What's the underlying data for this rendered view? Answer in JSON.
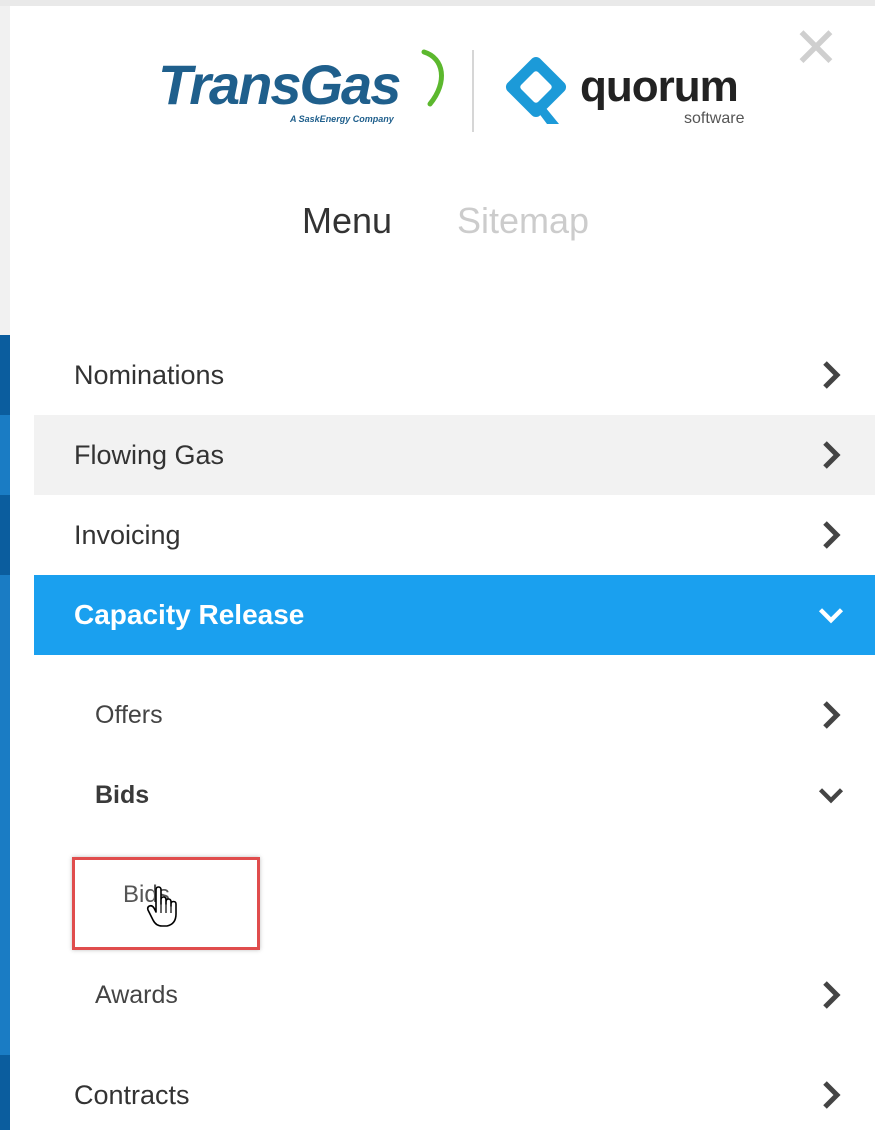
{
  "logo": {
    "transgas": "TransGas",
    "transgas_tagline": "A SaskEnergy Company",
    "quorum": "quorum",
    "quorum_sub": "software"
  },
  "close_glyph": "✕",
  "tabs": {
    "menu": "Menu",
    "sitemap": "Sitemap"
  },
  "menu": {
    "nominations": "Nominations",
    "flowing_gas": "Flowing Gas",
    "invoicing": "Invoicing",
    "capacity_release": "Capacity Release",
    "offers": "Offers",
    "bids": "Bids",
    "bids_child": "Bids",
    "awards": "Awards",
    "contracts": "Contracts"
  },
  "colors": {
    "active_row": "#1aa0ef",
    "hover_row": "#f2f2f2",
    "strip_dark": "#0b5d9e",
    "strip_light": "#1a7cc4",
    "highlight_box": "#e04d4d",
    "transgas_blue": "#1f5f8c"
  }
}
